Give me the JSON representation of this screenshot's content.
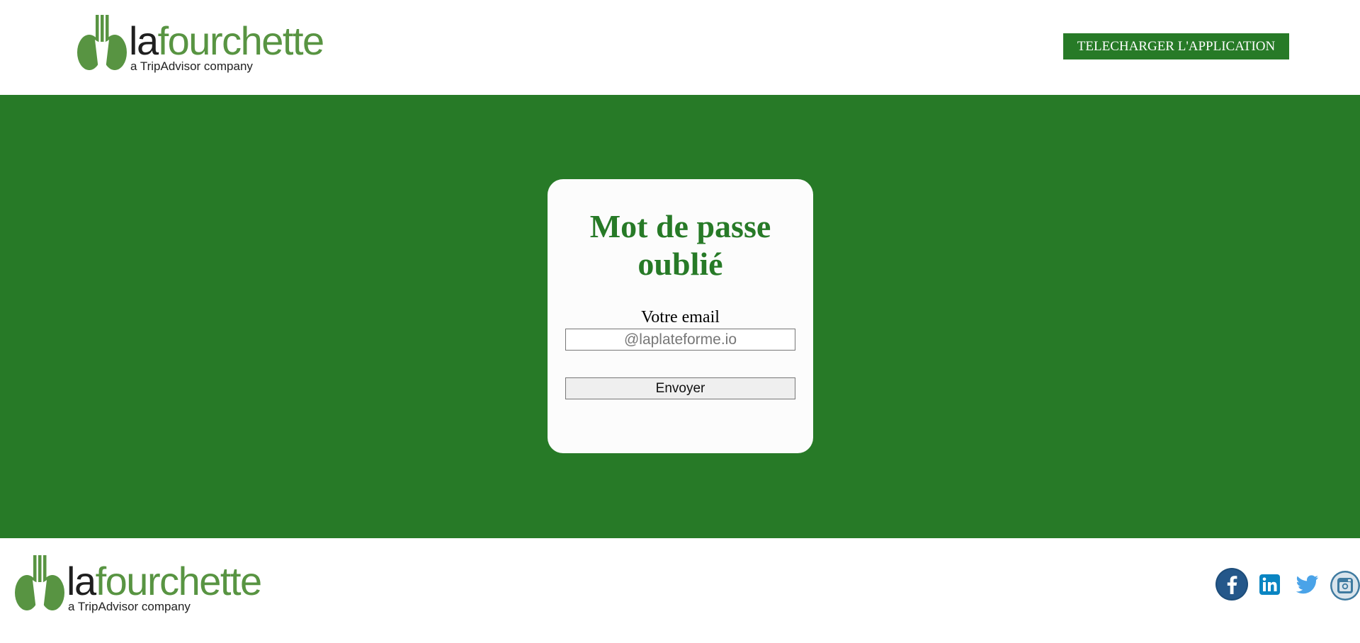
{
  "header": {
    "brand": {
      "prefix": "la",
      "name": "fourchette",
      "tagline": "a TripAdvisor company"
    },
    "download_button": "TELECHARGER L'APPLICATION"
  },
  "card": {
    "title": "Mot de passe oublié",
    "email_label": "Votre email",
    "email_value": "",
    "email_placeholder": "@laplateforme.io",
    "submit_label": "Envoyer"
  },
  "footer": {
    "brand": {
      "prefix": "la",
      "name": "fourchette",
      "tagline": "a TripAdvisor company"
    },
    "social": [
      {
        "name": "facebook-icon"
      },
      {
        "name": "linkedin-icon"
      },
      {
        "name": "twitter-icon"
      },
      {
        "name": "instagram-icon"
      }
    ]
  },
  "colors": {
    "brand_green": "#277a27",
    "logo_green": "#589442",
    "card_background": "#fcfcfc",
    "facebook_blue": "#1d4d7a",
    "linkedin_blue": "#0a85c2",
    "twitter_blue": "#4aa3e8",
    "instagram_blue": "#3e7aa0"
  }
}
